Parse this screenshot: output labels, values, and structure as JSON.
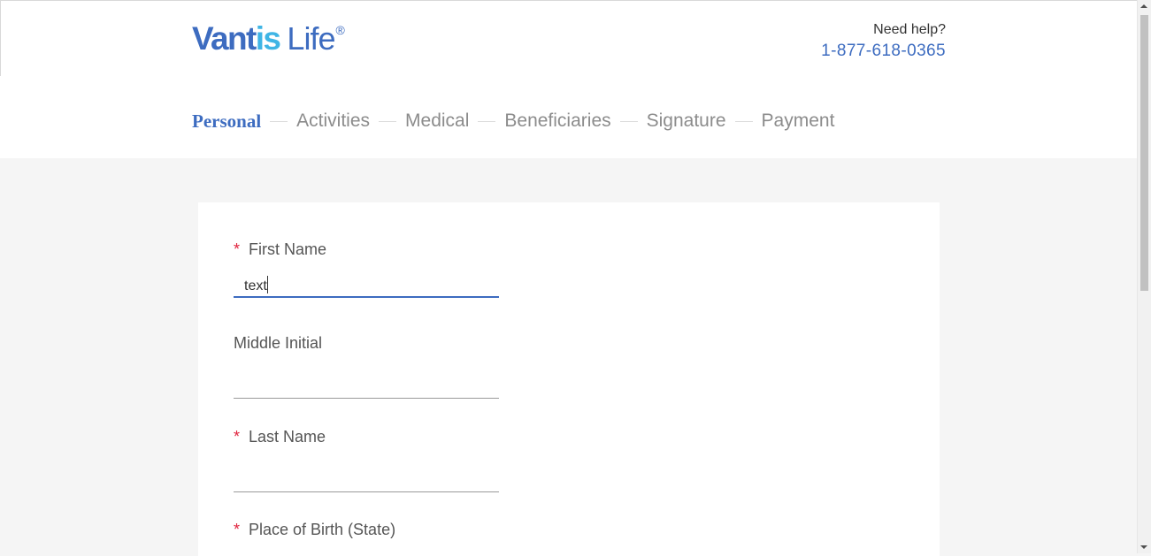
{
  "brand": {
    "part1": "Vant",
    "part2": "is",
    "part3": "Life",
    "registered": "®"
  },
  "help": {
    "label": "Need help?",
    "phone": "1-877-618-0365"
  },
  "steps": [
    {
      "label": "Personal",
      "active": true
    },
    {
      "label": "Activities"
    },
    {
      "label": "Medical"
    },
    {
      "label": "Beneficiaries"
    },
    {
      "label": "Signature"
    },
    {
      "label": "Payment"
    }
  ],
  "form": {
    "required_mark": "*",
    "first_name": {
      "label": "First Name",
      "value": "text"
    },
    "middle_initial": {
      "label": "Middle Initial",
      "value": ""
    },
    "last_name": {
      "label": "Last Name",
      "value": ""
    },
    "place_of_birth": {
      "label": "Place of Birth (State)"
    }
  },
  "colors": {
    "accent": "#3d6cc0",
    "brand_light": "#3fb5e5",
    "required": "#e0233d",
    "page_bg": "#f5f5f5"
  }
}
